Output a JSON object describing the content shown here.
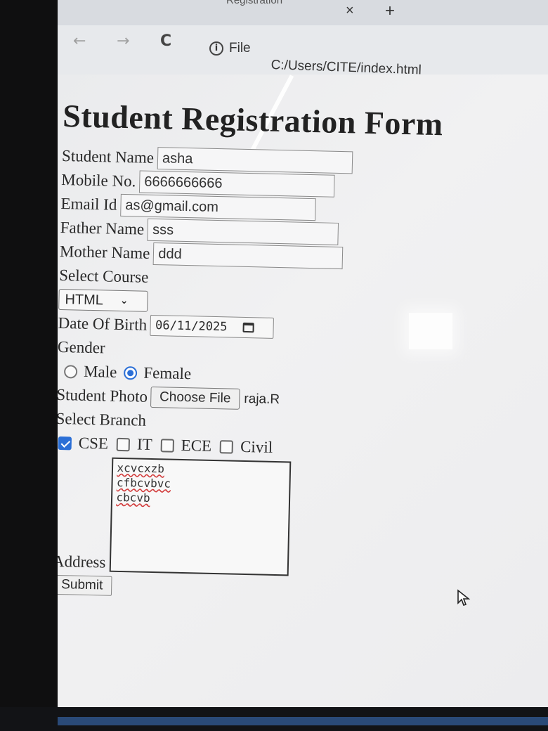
{
  "browser": {
    "tab_title": "Registration",
    "tab_close": "×",
    "new_tab": "+",
    "back": "←",
    "forward": "→",
    "reload": "C",
    "site_info_icon": "i",
    "site_info_label": "File",
    "url": "C:/Users/CITE/index.html"
  },
  "form": {
    "title": "Student Registration Form",
    "student_name": {
      "label": "Student Name",
      "value": "asha"
    },
    "mobile": {
      "label": "Mobile No.",
      "value": "6666666666"
    },
    "email": {
      "label": "Email Id",
      "value": "as@gmail.com"
    },
    "father_name": {
      "label": "Father Name",
      "value": "sss"
    },
    "mother_name": {
      "label": "Mother Name",
      "value": "ddd"
    },
    "course": {
      "label": "Select Course",
      "selected": "HTML"
    },
    "dob": {
      "label": "Date Of Birth",
      "value": "06/11/2025"
    },
    "gender": {
      "label": "Gender",
      "options": [
        {
          "label": "Male",
          "checked": false
        },
        {
          "label": "Female",
          "checked": true
        }
      ]
    },
    "photo": {
      "label": "Student Photo",
      "button": "Choose File",
      "file_name": "raja.R"
    },
    "branch": {
      "label": "Select Branch",
      "options": [
        {
          "label": "CSE",
          "checked": true
        },
        {
          "label": "IT",
          "checked": false
        },
        {
          "label": "ECE",
          "checked": false
        },
        {
          "label": "Civil",
          "checked": false
        }
      ]
    },
    "address": {
      "label": "Address",
      "lines": [
        "xcvcxzb",
        "cfbcvbvc",
        "cbcvb"
      ]
    },
    "submit": "Submit"
  },
  "colors": {
    "accent": "#2b6fd6",
    "spellcheck": "#d23c3c"
  }
}
